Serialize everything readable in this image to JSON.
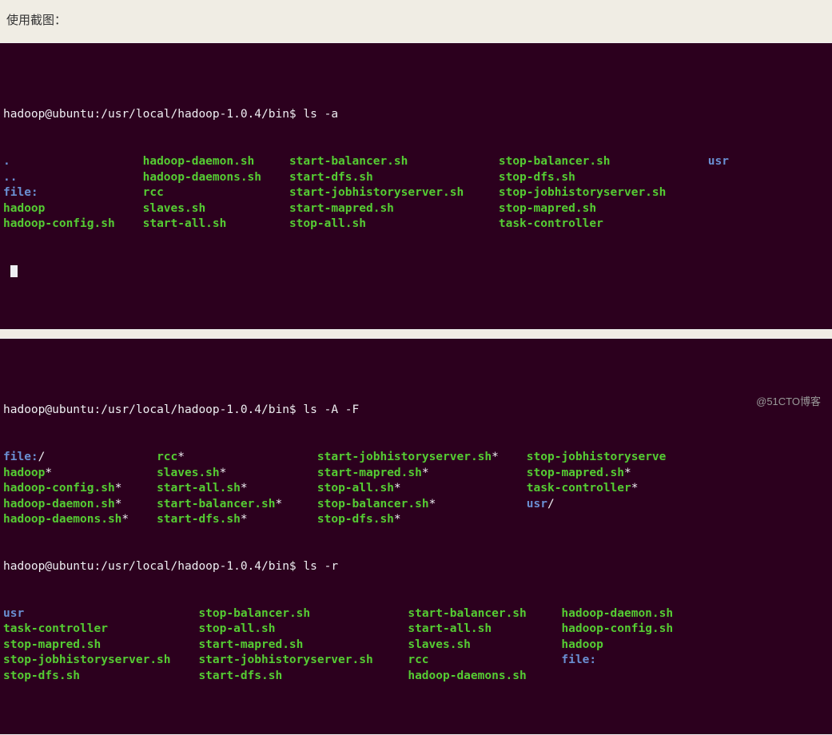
{
  "caption": "使用截图：",
  "watermark": "@51CTO博客",
  "term1": {
    "prompt_user": "hadoop@ubuntu",
    "prompt_path": ":/usr/local/hadoop-1.0.4/bin$",
    "command": " ls -a",
    "cols": [
      {
        "items": [
          {
            "text": ".",
            "cls": "blue"
          },
          {
            "text": "..",
            "cls": "blue"
          },
          {
            "text": "file:",
            "cls": "blue"
          },
          {
            "text": "hadoop",
            "cls": "green"
          },
          {
            "text": "hadoop-config.sh",
            "cls": "green"
          }
        ]
      },
      {
        "items": [
          {
            "text": "hadoop-daemon.sh",
            "cls": "green"
          },
          {
            "text": "hadoop-daemons.sh",
            "cls": "green"
          },
          {
            "text": "rcc",
            "cls": "green"
          },
          {
            "text": "slaves.sh",
            "cls": "green"
          },
          {
            "text": "start-all.sh",
            "cls": "green"
          }
        ]
      },
      {
        "items": [
          {
            "text": "start-balancer.sh",
            "cls": "green"
          },
          {
            "text": "start-dfs.sh",
            "cls": "green"
          },
          {
            "text": "start-jobhistoryserver.sh",
            "cls": "green"
          },
          {
            "text": "start-mapred.sh",
            "cls": "green"
          },
          {
            "text": "stop-all.sh",
            "cls": "green"
          }
        ]
      },
      {
        "items": [
          {
            "text": "stop-balancer.sh",
            "cls": "green"
          },
          {
            "text": "stop-dfs.sh",
            "cls": "green"
          },
          {
            "text": "stop-jobhistoryserver.sh",
            "cls": "green"
          },
          {
            "text": "stop-mapred.sh",
            "cls": "green"
          },
          {
            "text": "task-controller",
            "cls": "green"
          }
        ]
      },
      {
        "items": [
          {
            "text": "usr",
            "cls": "blue"
          }
        ]
      }
    ]
  },
  "term2": {
    "prompt_user": "hadoop@ubuntu",
    "prompt_path": ":/usr/local/hadoop-1.0.4/bin$",
    "command1": " ls -A -F",
    "cols1": [
      {
        "items": [
          {
            "text": "file:",
            "cls": "blue",
            "suffix": "/"
          },
          {
            "text": "hadoop",
            "cls": "green",
            "suffix": "*"
          },
          {
            "text": "hadoop-config.sh",
            "cls": "green",
            "suffix": "*"
          },
          {
            "text": "hadoop-daemon.sh",
            "cls": "green",
            "suffix": "*"
          },
          {
            "text": "hadoop-daemons.sh",
            "cls": "green",
            "suffix": "*"
          }
        ]
      },
      {
        "items": [
          {
            "text": "rcc",
            "cls": "green",
            "suffix": "*"
          },
          {
            "text": "slaves.sh",
            "cls": "green",
            "suffix": "*"
          },
          {
            "text": "start-all.sh",
            "cls": "green",
            "suffix": "*"
          },
          {
            "text": "start-balancer.sh",
            "cls": "green",
            "suffix": "*"
          },
          {
            "text": "start-dfs.sh",
            "cls": "green",
            "suffix": "*"
          }
        ]
      },
      {
        "items": [
          {
            "text": "start-jobhistoryserver.sh",
            "cls": "green",
            "suffix": "*"
          },
          {
            "text": "start-mapred.sh",
            "cls": "green",
            "suffix": "*"
          },
          {
            "text": "stop-all.sh",
            "cls": "green",
            "suffix": "*"
          },
          {
            "text": "stop-balancer.sh",
            "cls": "green",
            "suffix": "*"
          },
          {
            "text": "stop-dfs.sh",
            "cls": "green",
            "suffix": "*"
          }
        ]
      },
      {
        "items": [
          {
            "text": "stop-jobhistoryserve",
            "cls": "green",
            "suffix": ""
          },
          {
            "text": "stop-mapred.sh",
            "cls": "green",
            "suffix": "*"
          },
          {
            "text": "task-controller",
            "cls": "green",
            "suffix": "*"
          },
          {
            "text": "usr",
            "cls": "blue",
            "suffix": "/"
          }
        ]
      }
    ],
    "command2": " ls -r",
    "cols2": [
      {
        "items": [
          {
            "text": "usr",
            "cls": "blue"
          },
          {
            "text": "task-controller",
            "cls": "green"
          },
          {
            "text": "stop-mapred.sh",
            "cls": "green"
          },
          {
            "text": "stop-jobhistoryserver.sh",
            "cls": "green"
          },
          {
            "text": "stop-dfs.sh",
            "cls": "green"
          }
        ]
      },
      {
        "items": [
          {
            "text": "stop-balancer.sh",
            "cls": "green"
          },
          {
            "text": "stop-all.sh",
            "cls": "green"
          },
          {
            "text": "start-mapred.sh",
            "cls": "green"
          },
          {
            "text": "start-jobhistoryserver.sh",
            "cls": "green"
          },
          {
            "text": "start-dfs.sh",
            "cls": "green"
          }
        ]
      },
      {
        "items": [
          {
            "text": "start-balancer.sh",
            "cls": "green"
          },
          {
            "text": "start-all.sh",
            "cls": "green"
          },
          {
            "text": "slaves.sh",
            "cls": "green"
          },
          {
            "text": "rcc",
            "cls": "green"
          },
          {
            "text": "hadoop-daemons.sh",
            "cls": "green"
          }
        ]
      },
      {
        "items": [
          {
            "text": "hadoop-daemon.sh",
            "cls": "green"
          },
          {
            "text": "hadoop-config.sh",
            "cls": "green"
          },
          {
            "text": "hadoop",
            "cls": "green"
          },
          {
            "text": "file:",
            "cls": "blue"
          }
        ]
      }
    ]
  }
}
